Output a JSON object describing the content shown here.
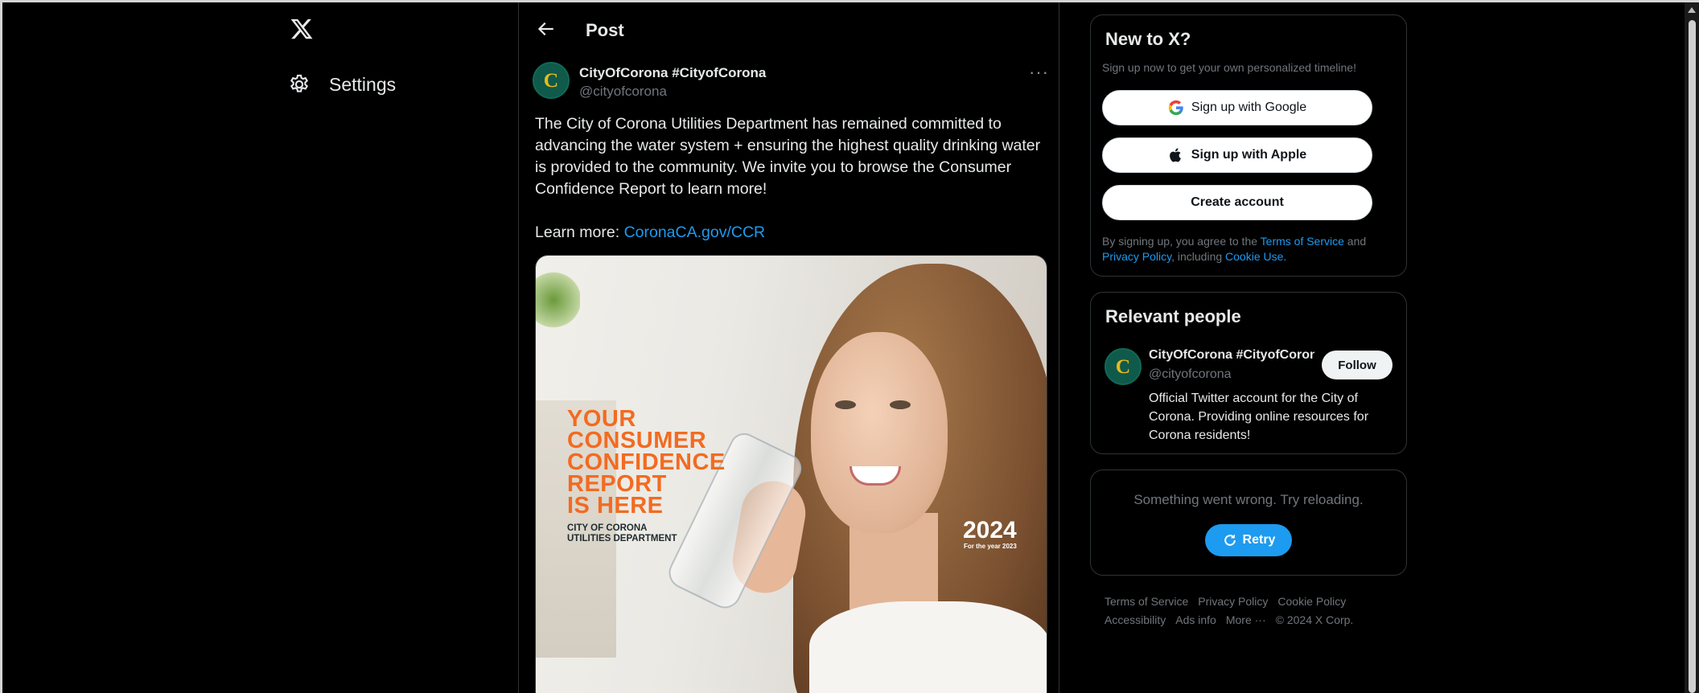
{
  "nav": {
    "settings_label": "Settings"
  },
  "header": {
    "title": "Post"
  },
  "post": {
    "author_name": "CityOfCorona #CityofCorona",
    "author_handle": "@cityofcorona",
    "text": "The City of Corona Utilities Department has remained committed to\nadvancing the water system + ensuring the highest quality drinking water\nis provided to the community. We invite you to browse the Consumer\nConfidence Report to learn more!",
    "learn_more_label": "Learn more: ",
    "learn_more_link": "CoronaCA.gov/CCR",
    "media": {
      "headline": [
        "YOUR",
        "CONSUMER",
        "CONFIDENCE",
        "REPORT",
        "IS HERE"
      ],
      "subline": [
        "CITY OF CORONA",
        "UTILITIES DEPARTMENT"
      ],
      "year": "2024",
      "year_sub": "For the year 2023"
    }
  },
  "signup": {
    "title": "New to X?",
    "subtitle": "Sign up now to get your own personalized timeline!",
    "google_label": "Sign up with Google",
    "apple_label": "Sign up with Apple",
    "create_label": "Create account",
    "legal_prefix": "By signing up, you agree to the ",
    "terms_link": "Terms of Service",
    "legal_and": " and",
    "privacy_link": "Privacy Policy",
    "legal_including": ", including ",
    "cookie_link": "Cookie Use."
  },
  "relevant": {
    "title": "Relevant people",
    "name": "CityOfCorona #CityofCorona",
    "handle": "@cityofcorona",
    "bio": "Official Twitter account for the City of Corona. Providing online resources for Corona residents!",
    "follow_label": "Follow"
  },
  "error_card": {
    "message": "Something went wrong. Try reloading.",
    "retry_label": "Retry"
  },
  "footer": {
    "terms": "Terms of Service",
    "privacy": "Privacy Policy",
    "cookie": "Cookie Policy",
    "accessibility": "Accessibility",
    "ads": "Ads info",
    "more": "More ···",
    "copyright": "© 2024 X Corp."
  },
  "colors": {
    "background": "#000000",
    "accent": "#1d9bf0",
    "orange": "#f26b21"
  }
}
